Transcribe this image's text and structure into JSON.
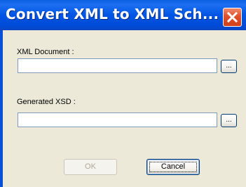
{
  "window": {
    "title": "Convert XML to XML Sch..."
  },
  "icons": {
    "close": "close-icon"
  },
  "form": {
    "xml_document_label": "XML Document :",
    "xml_document_value": "",
    "browse1_label": "...",
    "generated_xsd_label": "Generated XSD :",
    "generated_xsd_value": "",
    "browse2_label": "..."
  },
  "buttons": {
    "ok_label": "OK",
    "ok_enabled": false,
    "cancel_label": "Cancel"
  },
  "colors": {
    "titlebar": "#0055e5",
    "dialog_background": "#ece9d8",
    "close_button": "#e0502c"
  }
}
